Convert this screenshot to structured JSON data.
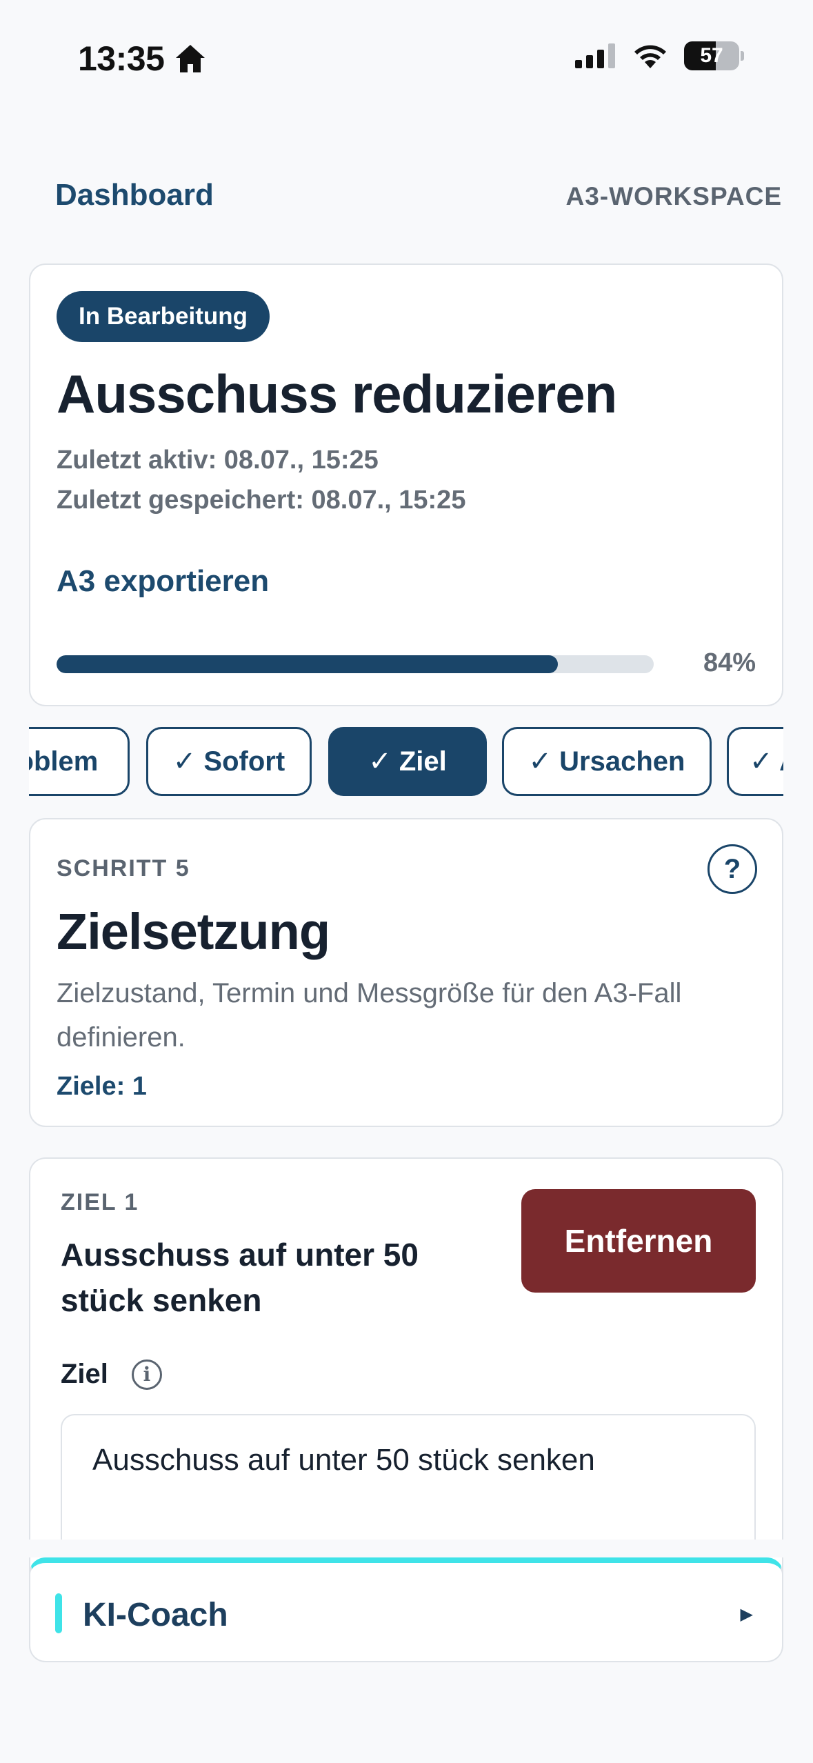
{
  "status_bar": {
    "time": "13:35",
    "battery": "57"
  },
  "header": {
    "back_label": "Dashboard",
    "section_label": "A3-WORKSPACE"
  },
  "case": {
    "status_badge": "In Bearbeitung",
    "title": "Ausschuss reduzieren",
    "last_active": "Zuletzt aktiv: 08.07., 15:25",
    "last_saved": "Zuletzt gespeichert: 08.07., 15:25",
    "export_label": "A3 exportieren",
    "progress_percent": 84,
    "progress_label": "84%"
  },
  "steps": {
    "tabs": [
      {
        "label": "✓ Problem",
        "active": false
      },
      {
        "label": "✓ Sofort",
        "active": false
      },
      {
        "label": "✓ Ziel",
        "active": true
      },
      {
        "label": "✓ Ursachen",
        "active": false
      },
      {
        "label": "✓ A",
        "active": false
      }
    ]
  },
  "step": {
    "number_label": "SCHRITT 5",
    "help_label": "?",
    "title": "Zielsetzung",
    "description": "Zielzustand, Termin und Messgröße für den A3-Fall definieren.",
    "goal_count": "Ziele: 1"
  },
  "goal": {
    "label": "ZIEL 1",
    "title": "Ausschuss auf unter 50 stück senken",
    "remove_label": "Entfernen",
    "field_label": "Ziel",
    "field_value": "Ausschuss auf unter 50 stück senken"
  },
  "coach": {
    "title": "KI-Coach",
    "toggle": "▶"
  },
  "colors": {
    "primary": "#1a4569",
    "danger": "#7a2a2d",
    "accent": "#3fe3e8"
  }
}
